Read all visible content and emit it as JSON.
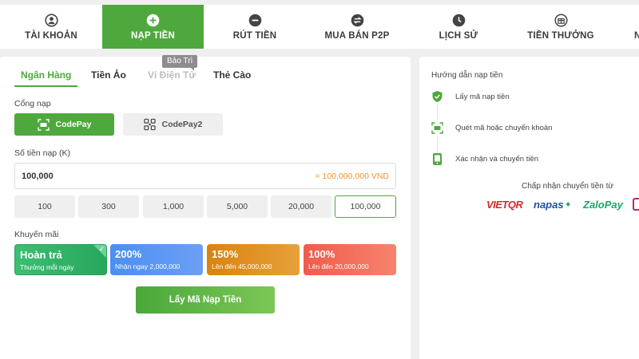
{
  "nav": {
    "items": [
      {
        "label": "TÀI KHOẢN",
        "icon": "account-icon"
      },
      {
        "label": "NẠP TIỀN",
        "icon": "plus-icon",
        "active": true
      },
      {
        "label": "RÚT TIỀN",
        "icon": "minus-icon"
      },
      {
        "label": "MUA BÁN P2P",
        "icon": "swap-icon"
      },
      {
        "label": "LỊCH SỬ",
        "icon": "clock-icon"
      },
      {
        "label": "TIỀN THƯỞNG",
        "icon": "gift-icon"
      },
      {
        "label": "N",
        "icon": "partial-icon"
      }
    ]
  },
  "tabs": [
    {
      "label": "Ngân Hàng",
      "active": true
    },
    {
      "label": "Tiền Ảo"
    },
    {
      "label": "Ví Điện Tử",
      "disabled": true
    },
    {
      "label": "Thẻ Cào"
    }
  ],
  "maintenance_badge": "Bảo Trì",
  "gateway": {
    "label": "Cổng nạp",
    "options": [
      {
        "label": "CodePay",
        "active": true,
        "icon": "scan-icon"
      },
      {
        "label": "CodePay2",
        "active": false,
        "icon": "qr-grid-icon"
      }
    ]
  },
  "amount": {
    "label": "Số tiền nạp (K)",
    "value": "100,000",
    "converted": "= 100,000,000 VND"
  },
  "presets": [
    "100",
    "300",
    "1,000",
    "5,000",
    "20,000",
    "100,000"
  ],
  "selected_preset": "100,000",
  "promotions": {
    "label": "Khuyến mãi",
    "items": [
      {
        "title": "Hoàn trả",
        "subtitle": "Thưởng mỗi ngày",
        "selected": true
      },
      {
        "title": "200%",
        "subtitle": "Nhận ngay 2,000,000"
      },
      {
        "title": "150%",
        "subtitle": "Lên đến 45,000,000"
      },
      {
        "title": "100%",
        "subtitle": "Lên đến 20,000,000"
      }
    ]
  },
  "submit_label": "Lấy Mã Nạp Tiền",
  "guide": {
    "title": "Hướng dẫn nạp tiền",
    "steps": [
      {
        "label": "Lấy mã nạp tiền",
        "icon": "shield-check-icon"
      },
      {
        "label": "Quét mã hoặc chuyển khoản",
        "icon": "scan-icon"
      },
      {
        "label": "Xác nhận và chuyển tiền",
        "icon": "phone-icon"
      }
    ]
  },
  "accept": {
    "title": "Chấp nhận chuyển tiền từ",
    "partners": [
      "VIETQR",
      "napas",
      "ZaloPay"
    ]
  },
  "colors": {
    "brand_green": "#4fa83d",
    "amount_orange": "#f0922c"
  }
}
